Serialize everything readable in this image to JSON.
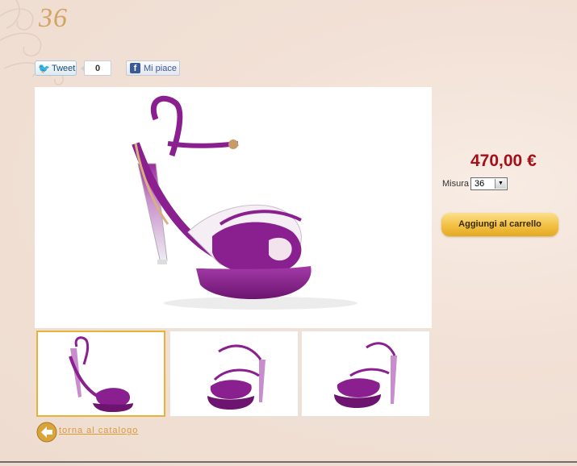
{
  "header": {
    "size_heading": "36"
  },
  "social": {
    "tweet_label": "Tweet",
    "tweet_count": "0",
    "like_label": "Mi piace",
    "facebook_glyph": "f"
  },
  "product": {
    "price": "470,00 €",
    "size_label": "Misura",
    "size_selected": "36",
    "add_to_cart_label": "Aggiungi al carrello"
  },
  "gallery": {
    "main_image": "purple-sandal-side-view",
    "thumbnails": [
      "purple-sandal-side-view",
      "purple-sandal-three-quarter-left",
      "purple-sandal-three-quarter-right"
    ],
    "active_thumbnail": 0
  },
  "nav": {
    "back_label": "torna al catalogo"
  },
  "colors": {
    "background": "#f2e1d6",
    "price": "#a50f17",
    "accent_gold": "#e8b23a",
    "shoe_purple": "#8a1f8f",
    "link": "#d99a38"
  }
}
